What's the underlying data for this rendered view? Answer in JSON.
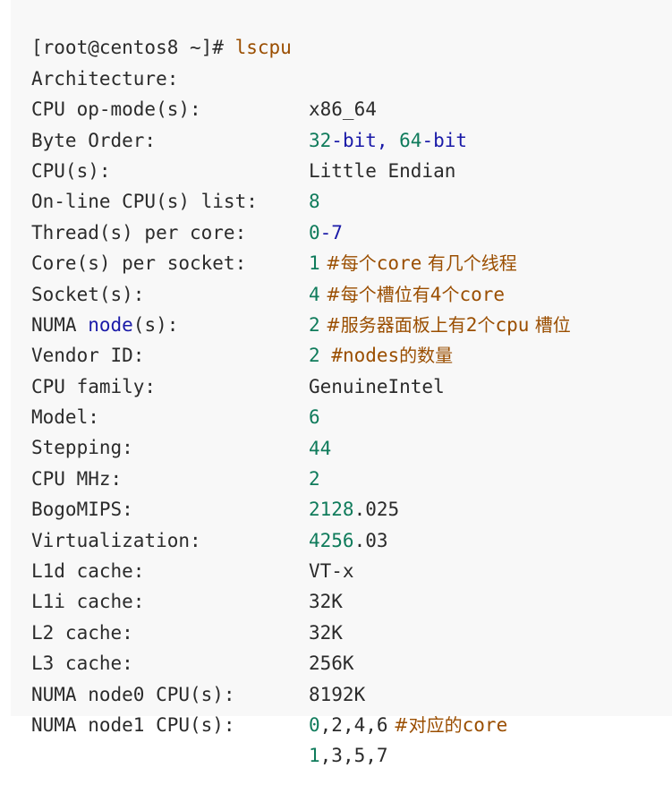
{
  "prompt": {
    "user_host": "[root@centos8 ~]#",
    "command": "lscpu"
  },
  "colors": {
    "background": "#f8f8f8",
    "text": "#2b2b2b",
    "number": "#0f7b5b",
    "keyword": "#1a1aa8",
    "comment": "#9a4e00"
  },
  "rows": [
    {
      "key": "Architecture:",
      "value": "x86_64"
    },
    {
      "key": "CPU op-mode(s):",
      "value_a": "32",
      "value_b": "-bit, ",
      "value_c": "64",
      "value_d": "-bit"
    },
    {
      "key": "Byte Order:",
      "value": "Little Endian"
    },
    {
      "key": "CPU(s):",
      "value": "8"
    },
    {
      "key": "On-line CPU(s) list:",
      "value_a": "0",
      "value_b": "-7"
    },
    {
      "key": "Thread(s) per core:",
      "value": "1",
      "comment_a": " #每个",
      "comment_b": "core",
      "comment_c": " 有几个线程"
    },
    {
      "key": "Core(s) per socket:",
      "value": "4",
      "comment_a": " #每个槽位有",
      "comment_b": "4",
      "comment_c": "个",
      "comment_d": "core"
    },
    {
      "key": "Socket(s):",
      "value": "2",
      "comment_a": " #服务器面板上有",
      "comment_b": "2",
      "comment_c": "个",
      "comment_d": "cpu",
      "comment_e": " 槽位"
    },
    {
      "key_a": "NUMA ",
      "key_b": "node",
      "key_c": "(s):",
      "value": "2",
      "comment_a": " #nodes",
      "comment_b": "的数量"
    },
    {
      "key": "Vendor ID:",
      "value": "GenuineIntel"
    },
    {
      "key": "CPU family:",
      "value": "6"
    },
    {
      "key": "Model:",
      "value": "44"
    },
    {
      "key": "Stepping:",
      "value": "2"
    },
    {
      "key": "CPU MHz:",
      "value_a": "2128",
      "value_b": ".025"
    },
    {
      "key": "BogoMIPS:",
      "value_a": "4256",
      "value_b": ".03"
    },
    {
      "key": "Virtualization:",
      "value": "VT-x"
    },
    {
      "key": "L1d cache:",
      "value": "32K"
    },
    {
      "key": "L1i cache:",
      "value": "32K"
    },
    {
      "key": "L2 cache:",
      "value": "256K"
    },
    {
      "key": "L3 cache:",
      "value": "8192K"
    },
    {
      "key": "NUMA node0 CPU(s):",
      "value_a": "0",
      "value_b": ",2,4,6",
      "comment_a": " #对应的",
      "comment_b": "core"
    },
    {
      "key": "NUMA node1 CPU(s):",
      "value_a": "1",
      "value_b": ",3,5,7"
    }
  ]
}
